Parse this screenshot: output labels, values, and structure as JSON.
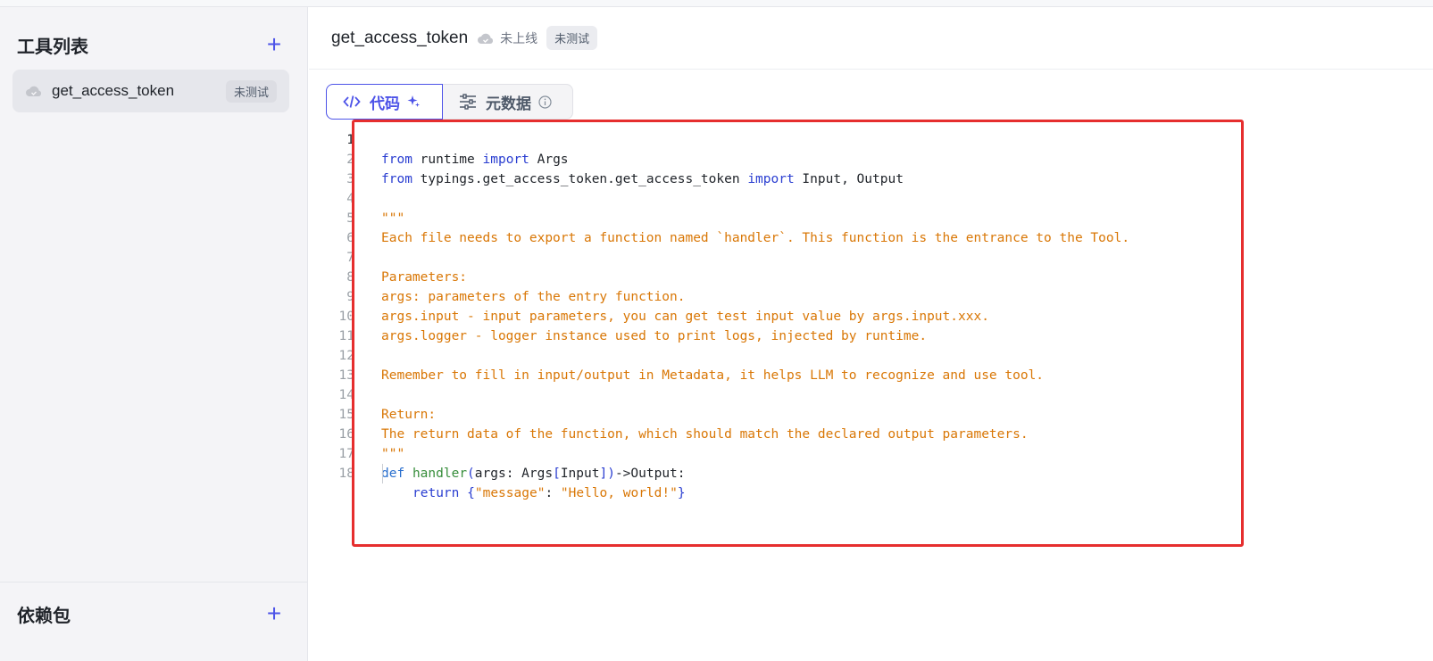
{
  "sidebar": {
    "title": "工具列表",
    "add_icon": "plus-icon",
    "tools": [
      {
        "name": "get_access_token",
        "badge": "未测试",
        "icon": "cloud-off-icon"
      }
    ],
    "deps_title": "依赖包"
  },
  "header": {
    "title": "get_access_token",
    "status": "未上线",
    "badge": "未测试"
  },
  "tabs": {
    "code_label": "代码",
    "meta_label": "元数据"
  },
  "editor": {
    "line_numbers": [
      "1",
      "2",
      "3",
      "4",
      "5",
      "6",
      "7",
      "8",
      "9",
      "10",
      "11",
      "12",
      "13",
      "14",
      "15",
      "16",
      "17",
      "18"
    ],
    "lines": {
      "l1": {
        "from": "from",
        "mod": " runtime ",
        "import": "import",
        "name": " Args"
      },
      "l2": {
        "from": "from",
        "mod": " typings.get_access_token.get_access_token ",
        "import": "import",
        "name": " Input, Output"
      },
      "l4": "\"\"\"",
      "l5": "Each file needs to export a function named `handler`. This function is the entrance to the Tool.",
      "l7": "Parameters:",
      "l8": "args: parameters of the entry function.",
      "l9": "args.input - input parameters, you can get test input value by args.input.xxx.",
      "l10": "args.logger - logger instance used to print logs, injected by runtime.",
      "l12": "Remember to fill in input/output in Metadata, it helps LLM to recognize and use tool.",
      "l14": "Return:",
      "l15": "The return data of the function, which should match the declared output parameters.",
      "l16": "\"\"\"",
      "l17": {
        "def": "def",
        "fn": "handler",
        "open": "(",
        "args": "args: Args",
        "lb": "[",
        "inp": "Input",
        "rb": "]",
        "close": ")",
        "ret": "->Output:"
      },
      "l18": {
        "return": "return",
        "lb": "{",
        "key": "\"message\"",
        "colon": ": ",
        "val": "\"Hello, world!\"",
        "rb": "}"
      }
    }
  }
}
